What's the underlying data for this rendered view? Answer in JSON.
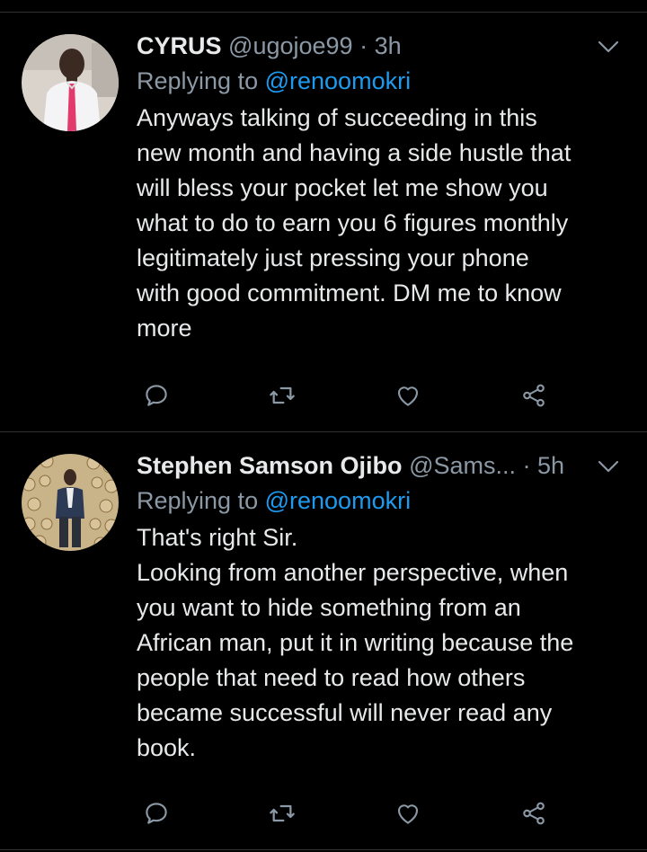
{
  "tweets": [
    {
      "display_name": "CYRUS",
      "handle": "@ugojoe99",
      "separator": "·",
      "time": "3h",
      "replying_prefix": "Replying to",
      "replying_to": "@renoomokri",
      "body_lines": [
        "Anyways talking of succeeding in this",
        "new month and having a side hustle that",
        "will bless your pocket let me show you",
        "what to do to earn you 6 figures monthly",
        "legitimately just pressing your phone",
        "with good commitment. DM me to know",
        "more"
      ],
      "actions": [
        "reply-icon",
        "retweet-icon",
        "like-icon",
        "share-icon"
      ]
    },
    {
      "display_name": "Stephen Samson Ojibo",
      "handle": "@Sams...",
      "separator": "·",
      "time": "5h",
      "replying_prefix": "Replying to",
      "replying_to": "@renoomokri",
      "body_lines": [
        "That's right Sir.",
        "Looking from another perspective, when",
        "you want to hide something from an",
        "African man, put it in writing because the",
        "people that need to read how others",
        "became successful will never read any",
        "book."
      ],
      "actions": [
        "reply-icon",
        "retweet-icon",
        "like-icon",
        "share-icon"
      ]
    }
  ],
  "colors": {
    "background": "#000000",
    "text": "#e7e9ea",
    "secondary_text": "#8b98a5",
    "link": "#1d9bf0",
    "divider": "#2f3336"
  }
}
